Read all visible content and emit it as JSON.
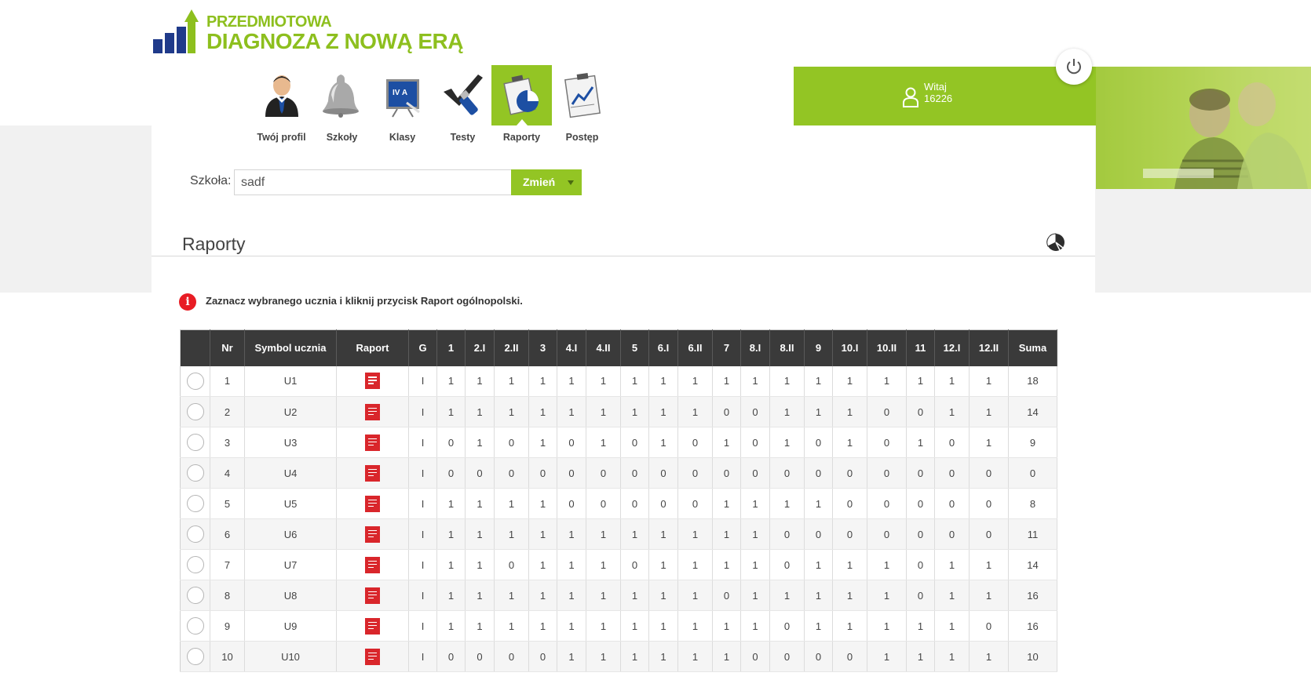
{
  "logo": {
    "line1": "PRZEDMIOTOWA",
    "line2": "DIAGNOZA Z NOWĄ ERĄ"
  },
  "nav": [
    {
      "label": "Twój profil",
      "icon": "user-profile-icon"
    },
    {
      "label": "Szkoły",
      "icon": "bell-icon"
    },
    {
      "label": "Klasy",
      "icon": "whiteboard-icon"
    },
    {
      "label": "Testy",
      "icon": "checkmark-pen-icon"
    },
    {
      "label": "Raporty",
      "icon": "pie-chart-report-icon",
      "active": true
    },
    {
      "label": "Postęp",
      "icon": "line-chart-clipboard-icon"
    }
  ],
  "welcome": {
    "greeting": "Witaj",
    "user_id": "16226"
  },
  "school": {
    "label": "Szkoła:",
    "value": "sadf",
    "button": "Zmień"
  },
  "section": {
    "title": "Raporty"
  },
  "info": {
    "message": "Zaznacz wybranego ucznia i kliknij przycisk Raport ogólnopolski."
  },
  "colors": {
    "accent_green": "#93c524",
    "header_dark": "#3a3a3a",
    "pdf_red": "#d9262b",
    "info_red": "#e81c24"
  },
  "table": {
    "headers": [
      "",
      "Nr",
      "Symbol ucznia",
      "Raport",
      "G",
      "1",
      "2.I",
      "2.II",
      "3",
      "4.I",
      "4.II",
      "5",
      "6.I",
      "6.II",
      "7",
      "8.I",
      "8.II",
      "9",
      "10.I",
      "10.II",
      "11",
      "12.I",
      "12.II",
      "Suma"
    ],
    "rows": [
      {
        "nr": "1",
        "symbol": "U1",
        "g": "I",
        "scores": [
          "1",
          "1",
          "1",
          "1",
          "1",
          "1",
          "1",
          "1",
          "1",
          "1",
          "1",
          "1",
          "1",
          "1",
          "1",
          "1",
          "1",
          "1"
        ],
        "sum": "18"
      },
      {
        "nr": "2",
        "symbol": "U2",
        "g": "I",
        "scores": [
          "1",
          "1",
          "1",
          "1",
          "1",
          "1",
          "1",
          "1",
          "1",
          "0",
          "0",
          "1",
          "1",
          "1",
          "0",
          "0",
          "1",
          "1"
        ],
        "sum": "14"
      },
      {
        "nr": "3",
        "symbol": "U3",
        "g": "I",
        "scores": [
          "0",
          "1",
          "0",
          "1",
          "0",
          "1",
          "0",
          "1",
          "0",
          "1",
          "0",
          "1",
          "0",
          "1",
          "0",
          "1",
          "0",
          "1"
        ],
        "sum": "9"
      },
      {
        "nr": "4",
        "symbol": "U4",
        "g": "I",
        "scores": [
          "0",
          "0",
          "0",
          "0",
          "0",
          "0",
          "0",
          "0",
          "0",
          "0",
          "0",
          "0",
          "0",
          "0",
          "0",
          "0",
          "0",
          "0"
        ],
        "sum": "0"
      },
      {
        "nr": "5",
        "symbol": "U5",
        "g": "I",
        "scores": [
          "1",
          "1",
          "1",
          "1",
          "0",
          "0",
          "0",
          "0",
          "0",
          "1",
          "1",
          "1",
          "1",
          "0",
          "0",
          "0",
          "0",
          "0"
        ],
        "sum": "8"
      },
      {
        "nr": "6",
        "symbol": "U6",
        "g": "I",
        "scores": [
          "1",
          "1",
          "1",
          "1",
          "1",
          "1",
          "1",
          "1",
          "1",
          "1",
          "1",
          "0",
          "0",
          "0",
          "0",
          "0",
          "0",
          "0"
        ],
        "sum": "11"
      },
      {
        "nr": "7",
        "symbol": "U7",
        "g": "I",
        "scores": [
          "1",
          "1",
          "0",
          "1",
          "1",
          "1",
          "0",
          "1",
          "1",
          "1",
          "1",
          "0",
          "1",
          "1",
          "1",
          "0",
          "1",
          "1"
        ],
        "sum": "14"
      },
      {
        "nr": "8",
        "symbol": "U8",
        "g": "I",
        "scores": [
          "1",
          "1",
          "1",
          "1",
          "1",
          "1",
          "1",
          "1",
          "1",
          "0",
          "1",
          "1",
          "1",
          "1",
          "1",
          "0",
          "1",
          "1"
        ],
        "sum": "16"
      },
      {
        "nr": "9",
        "symbol": "U9",
        "g": "I",
        "scores": [
          "1",
          "1",
          "1",
          "1",
          "1",
          "1",
          "1",
          "1",
          "1",
          "1",
          "1",
          "0",
          "1",
          "1",
          "1",
          "1",
          "1",
          "0"
        ],
        "sum": "16"
      },
      {
        "nr": "10",
        "symbol": "U10",
        "g": "I",
        "scores": [
          "0",
          "0",
          "0",
          "0",
          "1",
          "1",
          "1",
          "1",
          "1",
          "1",
          "0",
          "0",
          "0",
          "0",
          "1",
          "1",
          "1",
          "1"
        ],
        "sum": "10"
      }
    ]
  }
}
